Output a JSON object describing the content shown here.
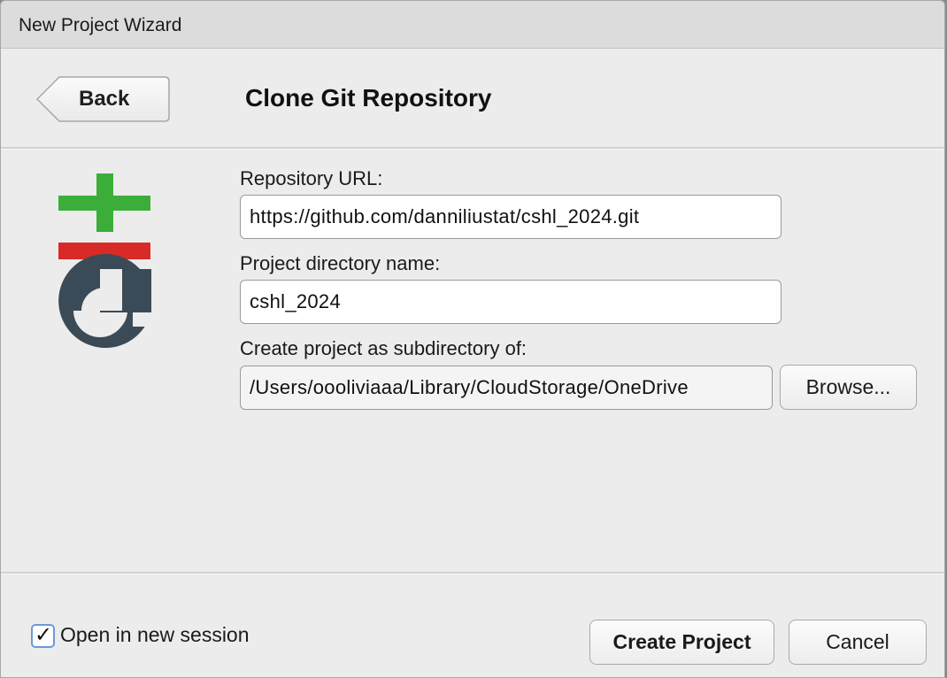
{
  "window": {
    "title": "New Project Wizard"
  },
  "header": {
    "back_label": "Back",
    "page_title": "Clone Git Repository"
  },
  "form": {
    "repo_url": {
      "label": "Repository URL:",
      "value": "https://github.com/danniliustat/cshl_2024.git"
    },
    "project_dir": {
      "label": "Project directory name:",
      "value": "cshl_2024"
    },
    "subdirectory": {
      "label": "Create project as subdirectory of:",
      "value": "/Users/oooliviaaa/Library/CloudStorage/OneDrive",
      "browse_label": "Browse..."
    }
  },
  "footer": {
    "open_new_session": {
      "label": "Open in new session",
      "checked": true
    },
    "create_label": "Create Project",
    "cancel_label": "Cancel"
  },
  "icons": {
    "logo": "git-logo-icon",
    "check": "checkmark-icon"
  },
  "colors": {
    "git_green": "#3bae3a",
    "git_red": "#d82b27",
    "git_dark": "#3a4b57",
    "focus_blue": "#6f97dc"
  }
}
